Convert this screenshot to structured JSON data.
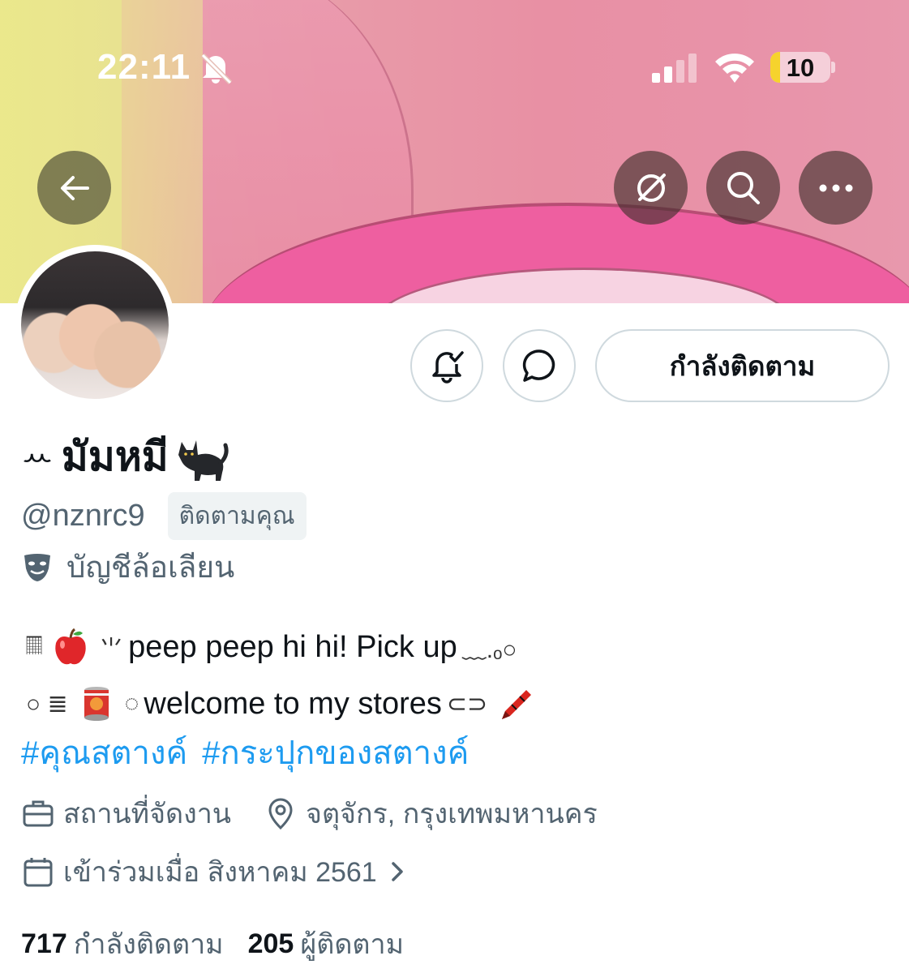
{
  "status_bar": {
    "time": "22:11",
    "battery_level": "10",
    "battery_fraction": 0.1,
    "icons": [
      "bell-slash-icon",
      "cellular-signal-icon",
      "wifi-icon",
      "battery-icon"
    ]
  },
  "header": {
    "buttons": [
      "back-arrow-icon",
      "grok-icon",
      "search-icon",
      "more-icon"
    ]
  },
  "actions": {
    "notify_icon": "bell-check-icon",
    "message_icon": "chat-bubble-icon",
    "following_label": "กำลังติดตาม"
  },
  "profile": {
    "name_prefix": "ꕀ",
    "display_name": "มัมหมี",
    "name_emoji": "black-cat-emoji",
    "handle": "@nznrc9",
    "follows_you": "ติดตามคุณ",
    "parody_label": "บัญชีล้อเลียน",
    "bio_line1": {
      "deco_start": "𝄜",
      "deco_mid": "⺌",
      "text": "peep peep hi hi! Pick up",
      "deco_end": "﹏.ₒ○"
    },
    "bio_line2": {
      "deco_start": "○ ≣",
      "deco_mid": "◌",
      "text": "welcome to my stores",
      "deco_end": "⊂⊃"
    },
    "hashtags": [
      "#คุณสตางค์",
      "#กระปุกของสตางค์"
    ],
    "category": "สถานที่จัดงาน",
    "location": "จตุจักร, กรุงเทพมหานคร",
    "joined": "เข้าร่วมเมื่อ สิงหาคม 2561"
  },
  "stats": {
    "following_count": "717",
    "following_label": "กำลังติดตาม",
    "followers_count": "205",
    "followers_label": "ผู้ติดตาม"
  },
  "colors": {
    "link": "#1d9bf0",
    "muted": "#536471",
    "text": "#0f1419",
    "border": "#cfd9de",
    "battery": "#f6d32d"
  }
}
